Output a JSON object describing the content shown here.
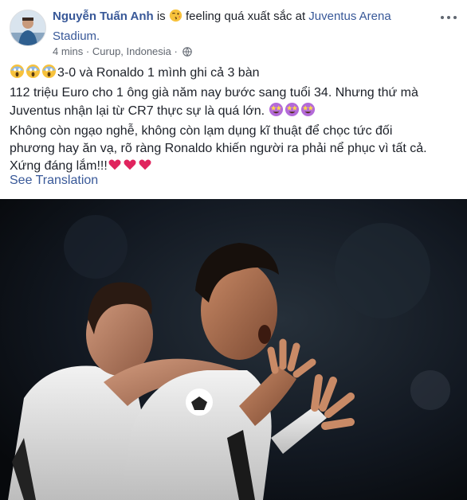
{
  "post": {
    "author": "Nguyễn Tuấn Anh",
    "is_text": " is ",
    "feeling_text": " feeling quá xuất sắc at ",
    "place": "Juventus Arena Stadium.",
    "meta": {
      "time": "4 mins",
      "sep": "·",
      "location": "Curup, Indonesia",
      "sep2": "·"
    },
    "lines": {
      "line1": "3-0 và Ronaldo 1 mình ghi cả 3 bàn",
      "line2": "112 triệu Euro cho 1 ông già năm nay bước sang tuổi 34. Nhưng thứ mà",
      "line3": "Juventus nhận lại từ CR7 thực sự là quá lớn. ",
      "line4": "Không còn ngạo nghễ, không còn lạm dụng kĩ thuật để chọc tức đối",
      "line5": "phương hay ăn vạ, rõ ràng Ronaldo khiến người ra phải nể phục vì tất cả.",
      "line6": "Xứng đáng lắm!!!"
    },
    "see_translation": "See Translation"
  },
  "icons": {
    "feeling": "winking-kiss-emoji-icon",
    "scream": "screaming-face-emoji-icon",
    "star_eyes": "star-struck-emoji-icon",
    "heart": "red-heart-icon",
    "globe": "globe-icon",
    "more": "more-options-icon"
  },
  "colors": {
    "link": "#385898",
    "text": "#1d2129",
    "meta": "#616770",
    "heart": "#e0245e"
  }
}
